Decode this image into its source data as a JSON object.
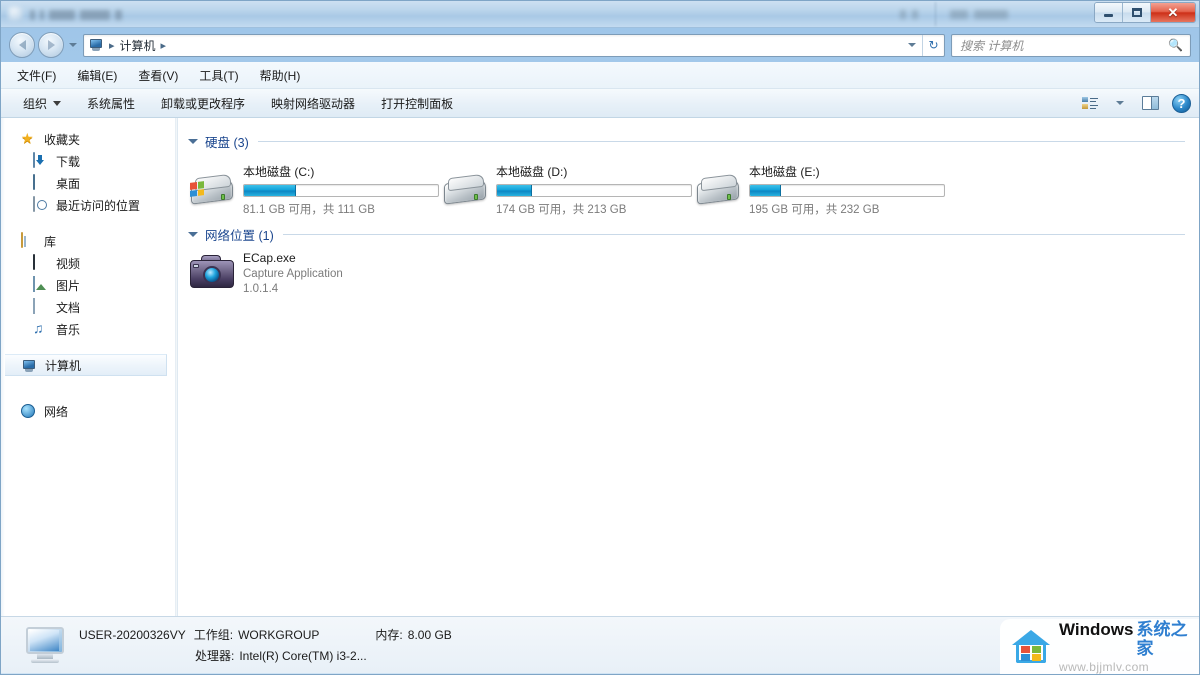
{
  "window": {
    "controls": {
      "minimize": "最小化",
      "maximize": "最大化",
      "close": "✕"
    }
  },
  "addressbar": {
    "back_label": "后退",
    "forward_label": "前进",
    "recent_label": "最近浏览的页面",
    "computer_icon": "computer-icon",
    "crumb": "计算机",
    "separator": "▸",
    "refresh_label": "刷新",
    "search": {
      "placeholder": "搜索 计算机",
      "icon": "search-icon"
    }
  },
  "menubar": {
    "items": [
      {
        "label": "文件(F)"
      },
      {
        "label": "编辑(E)"
      },
      {
        "label": "查看(V)"
      },
      {
        "label": "工具(T)"
      },
      {
        "label": "帮助(H)"
      }
    ]
  },
  "commandbar": {
    "items": [
      {
        "label": "组织",
        "has_caret": true
      },
      {
        "label": "系统属性",
        "has_caret": false
      },
      {
        "label": "卸载或更改程序",
        "has_caret": false
      },
      {
        "label": "映射网络驱动器",
        "has_caret": false
      },
      {
        "label": "打开控制面板",
        "has_caret": false
      }
    ],
    "right": {
      "view_label": "更改您的视图",
      "view_caret": "▾",
      "preview_label": "显示预览窗格",
      "help_label": "?"
    }
  },
  "navpane": {
    "groups": [
      {
        "header": {
          "label": "收藏夹",
          "icon": "star-icon"
        },
        "items": [
          {
            "label": "下载",
            "icon": "downloads-icon"
          },
          {
            "label": "桌面",
            "icon": "desktop-icon"
          },
          {
            "label": "最近访问的位置",
            "icon": "recent-places-icon"
          }
        ]
      },
      {
        "header": {
          "label": "库",
          "icon": "library-icon"
        },
        "items": [
          {
            "label": "视频",
            "icon": "video-icon"
          },
          {
            "label": "图片",
            "icon": "picture-icon"
          },
          {
            "label": "文档",
            "icon": "document-icon"
          },
          {
            "label": "音乐",
            "icon": "music-icon"
          }
        ]
      }
    ],
    "computer": {
      "label": "计算机",
      "icon": "computer-icon",
      "selected": true
    },
    "network": {
      "label": "网络",
      "icon": "network-icon"
    }
  },
  "content": {
    "groups": [
      {
        "id": "hard-disks",
        "title": "硬盘 (3)",
        "expanded": true
      },
      {
        "id": "network-locations",
        "title": "网络位置 (1)",
        "expanded": true
      }
    ],
    "drives": [
      {
        "name": "本地磁盘 (C:)",
        "capacity_text": "81.1 GB 可用，共 111 GB",
        "free_gb": 81.1,
        "total_gb": 111,
        "used_percent": 27,
        "is_system": true
      },
      {
        "name": "本地磁盘 (D:)",
        "capacity_text": "174 GB 可用，共 213 GB",
        "free_gb": 174,
        "total_gb": 213,
        "used_percent": 18,
        "is_system": false
      },
      {
        "name": "本地磁盘 (E:)",
        "capacity_text": "195 GB 可用，共 232 GB",
        "free_gb": 195,
        "total_gb": 232,
        "used_percent": 16,
        "is_system": false
      }
    ],
    "network_items": [
      {
        "name": "ECap.exe",
        "description": "Capture Application",
        "version": "1.0.1.4",
        "icon": "camera-icon"
      }
    ]
  },
  "statusbar": {
    "computer_name": "USER-20200326VY",
    "workgroup_label": "工作组:",
    "workgroup_value": "WORKGROUP",
    "memory_label": "内存:",
    "memory_value": "8.00 GB",
    "processor_label": "处理器:",
    "processor_value": "Intel(R) Core(TM) i3-2...",
    "icon": "computer-icon"
  },
  "watermark": {
    "brand_en": "Windows",
    "brand_cn": "系统之家",
    "url": "www.bjjmlv.com",
    "logo_colors": [
      "#e8533a",
      "#7ab83c",
      "#2d8fd5",
      "#f3b91c"
    ],
    "accent": "#3aa8e6"
  }
}
